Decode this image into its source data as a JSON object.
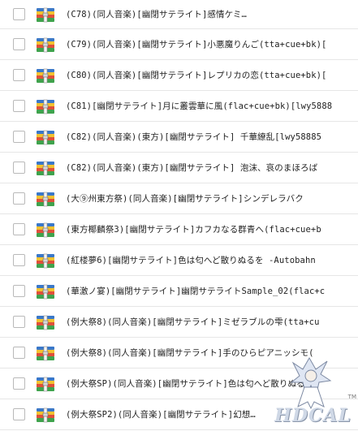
{
  "files": [
    {
      "name": "(C78)(同人音楽)[幽閉サテライト]感情ケミ…",
      "icon": "archive-icon"
    },
    {
      "name": "(C79)(同人音楽)[幽閉サテライト]小悪魔りんご(tta+cue+bk)[",
      "icon": "archive-icon"
    },
    {
      "name": "(C80)(同人音楽)[幽閉サテライト]レプリカの恋(tta+cue+bk)[",
      "icon": "archive-icon"
    },
    {
      "name": "(C81)[幽閉サテライト]月に叢雲華に風(flac+cue+bk)[lwy5888",
      "icon": "archive-icon"
    },
    {
      "name": "(C82)(同人音楽)(東方)[幽閉サテライト] 千華繚乱[lwy58885",
      "icon": "archive-icon"
    },
    {
      "name": "(C82)(同人音楽)(東方)[幽閉サテライト] 泡沫、哀のまほろば",
      "icon": "archive-icon"
    },
    {
      "name": "(大⑨州東方祭)(同人音楽)[幽閉サテライト]シンデレラバク",
      "icon": "archive-icon"
    },
    {
      "name": "(東方椰麟祭3)[幽閉サテライト]カフカなる群青へ(flac+cue+b",
      "icon": "archive-icon"
    },
    {
      "name": "(紅楼夢6)[幽閉サテライト]色は匂へど散りぬるを -Autobahn",
      "icon": "archive-icon"
    },
    {
      "name": "(華激ノ宴)[幽閉サテライト]幽閉サテライトSample_02(flac+c",
      "icon": "archive-icon"
    },
    {
      "name": "(例大祭8)(同人音楽)[幽閉サテライト]ミゼラブルの雫(tta+cu",
      "icon": "archive-icon"
    },
    {
      "name": "(例大祭8)(同人音楽)[幽閉サテライト]手のひらピアニッシモ(",
      "icon": "archive-icon"
    },
    {
      "name": "(例大祭SP)(同人音楽)[幽閉サテライト]色は匂へど散りぬるを",
      "icon": "archive-icon"
    },
    {
      "name": "(例大祭SP2)(同人音楽)[幽閉サテライト]幻想…",
      "icon": "archive-icon"
    }
  ],
  "watermark": {
    "text": "HDCAL",
    "mark": "TM"
  },
  "colors": {
    "border": "#e6e6e6",
    "text": "#222222",
    "archive_blue": "#3a78c9",
    "archive_yellow": "#f2c230",
    "archive_red": "#e0503a",
    "archive_green": "#3fa34d"
  }
}
